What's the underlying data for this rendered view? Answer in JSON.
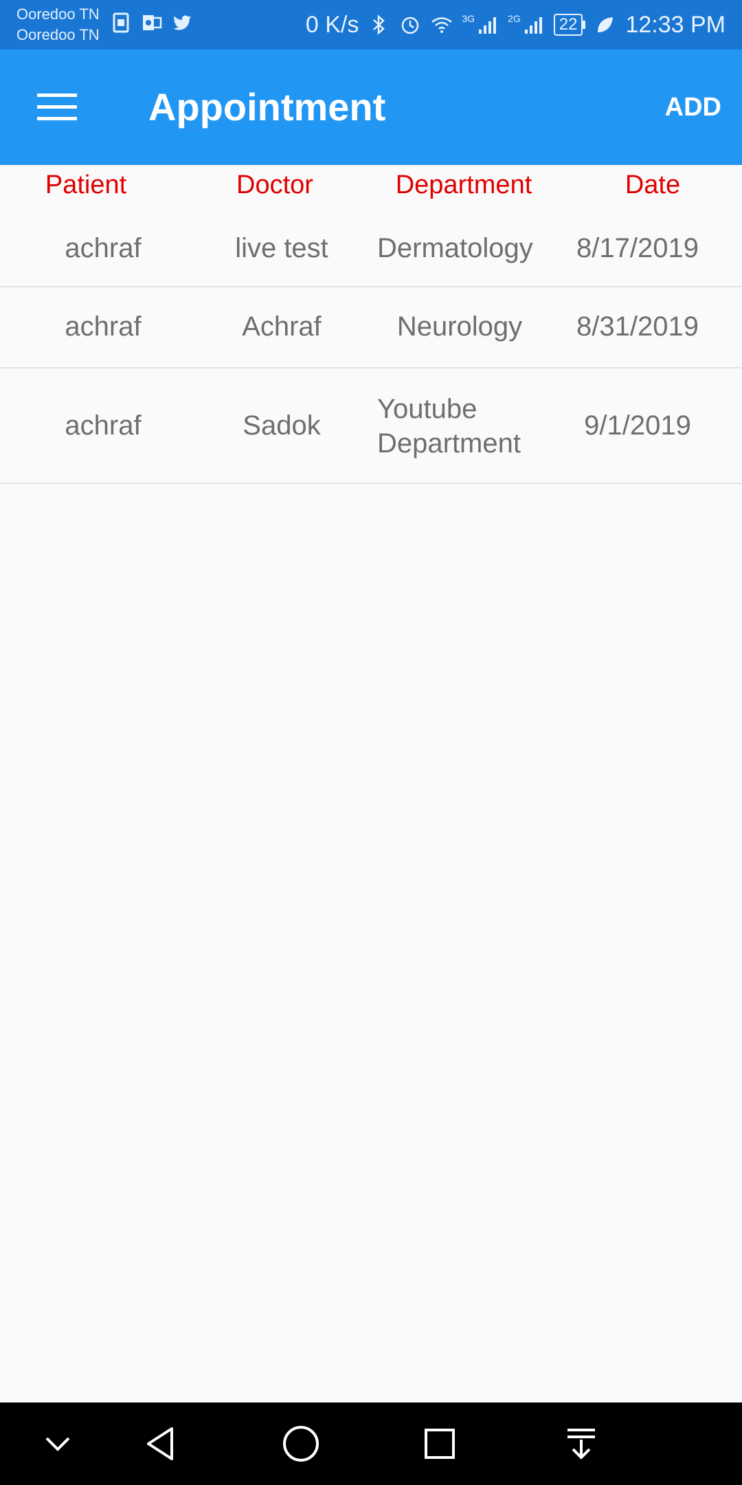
{
  "status_bar": {
    "carrier_1": "Ooredoo TN",
    "carrier_2": "Ooredoo TN",
    "net_speed": "0 K/s",
    "signal_1_label": "3G",
    "signal_2_label": "2G",
    "battery_level": "22",
    "time": "12:33 PM"
  },
  "app_bar": {
    "title": "Appointment",
    "add_label": "ADD",
    "menu_icon": "hamburger-menu-icon",
    "background": "#2196f3"
  },
  "table": {
    "headers": [
      "Patient",
      "Doctor",
      "Department",
      "Date"
    ],
    "header_color": "#e00000",
    "rows": [
      {
        "patient": "achraf",
        "doctor": "live test",
        "department": "Dermatology",
        "date": "8/17/2019"
      },
      {
        "patient": "achraf",
        "doctor": "Achraf",
        "department": "Neurology",
        "date": "8/31/2019"
      },
      {
        "patient": "achraf",
        "doctor": "Sadok",
        "department": "Youtube Department",
        "date": "9/1/2019"
      }
    ]
  },
  "nav_bar": {
    "icons": [
      "chevron-down-icon",
      "back-icon",
      "home-icon",
      "recents-icon",
      "notification-pull-icon"
    ]
  }
}
